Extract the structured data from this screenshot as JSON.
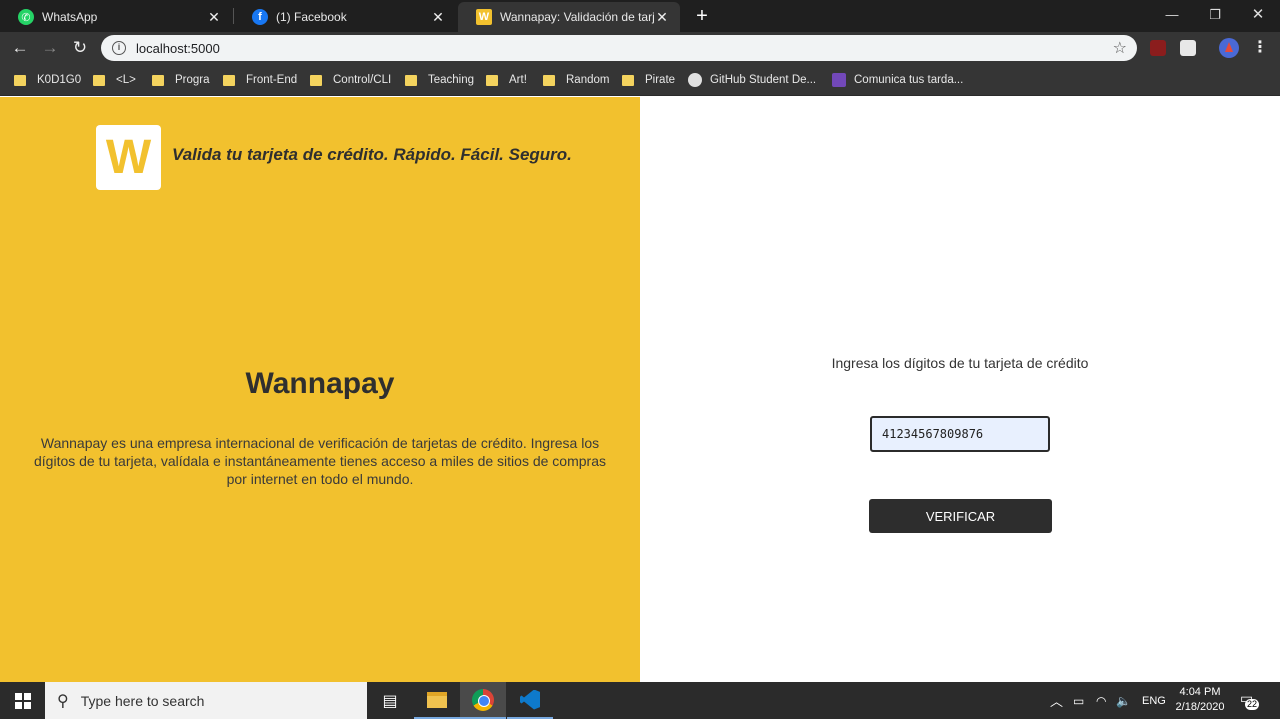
{
  "browser": {
    "tabs": [
      {
        "title": "WhatsApp",
        "icon": "whatsapp-icon"
      },
      {
        "title": "(1) Facebook",
        "icon": "facebook-icon"
      },
      {
        "title": "Wannapay: Validación de tarjetas",
        "icon": "wannapay-icon",
        "active": true
      }
    ],
    "url": "localhost:5000",
    "bookmarks": [
      "K0D1G0",
      "<L>",
      "Progra",
      "Front-End",
      "Control/CLI",
      "Teaching",
      "Art!",
      "Random",
      "Pirate",
      "GitHub Student De...",
      "Comunica tus tarda..."
    ]
  },
  "page": {
    "logo_letter": "W",
    "slogan": "Valida tu tarjeta de crédito. Rápido. Fácil. Seguro.",
    "brand": "Wannapay",
    "description": "Wannapay es una empresa internacional de verificación de tarjetas de crédito. Ingresa los dígitos de tu tarjeta, valídala e instantáneamente tienes acceso a miles de sitios de compras por internet en todo el mundo.",
    "prompt": "Ingresa los dígitos de tu tarjeta de crédito",
    "card_value": "41234567809876",
    "verify_label": "VERIFICAR",
    "colors": {
      "accent": "#f2c12e",
      "dark": "#2d2d2d"
    }
  },
  "taskbar": {
    "search_placeholder": "Type here to search",
    "language": "ENG",
    "time": "4:04 PM",
    "date": "2/18/2020",
    "notifications": "22"
  }
}
